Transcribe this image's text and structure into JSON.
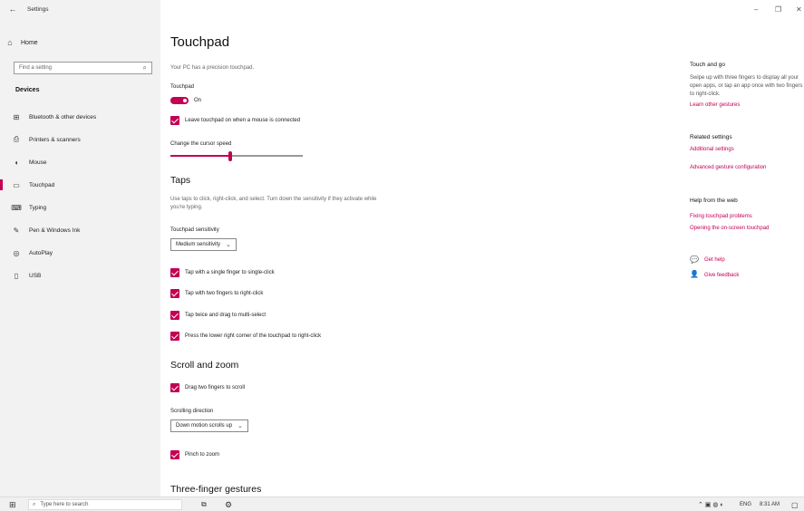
{
  "window": {
    "title": "Settings",
    "back_icon": "←",
    "minimize": "–",
    "restore": "❐",
    "close": "✕"
  },
  "sidebar": {
    "home": {
      "icon": "⌂",
      "label": "Home"
    },
    "search": {
      "placeholder": "Find a setting"
    },
    "section": "Devices",
    "items": [
      {
        "icon": "⊞",
        "label": "Bluetooth & other devices"
      },
      {
        "icon": "⎙",
        "label": "Printers & scanners"
      },
      {
        "icon": "◖",
        "label": "Mouse"
      },
      {
        "icon": "▭",
        "label": "Touchpad",
        "active": true
      },
      {
        "icon": "⌨",
        "label": "Typing"
      },
      {
        "icon": "✎",
        "label": "Pen & Windows Ink"
      },
      {
        "icon": "◎",
        "label": "AutoPlay"
      },
      {
        "icon": "▯",
        "label": "USB"
      }
    ]
  },
  "main": {
    "title": "Touchpad",
    "precision_note": "Your PC has a precision touchpad.",
    "touchpad_label": "Touchpad",
    "touchpad_state": "On",
    "leave_on_label": "Leave touchpad on when a mouse is connected",
    "cursor_speed_label": "Change the cursor speed",
    "cursor_speed_fraction": 0.45,
    "taps": {
      "heading": "Taps",
      "description": "Use taps to click, right-click, and select. Turn down the sensitivity if they activate while you're typing.",
      "sensitivity_label": "Touchpad sensitivity",
      "sensitivity_value": "Medium sensitivity",
      "options": [
        "Tap with a single finger to single-click",
        "Tap with two fingers to right-click",
        "Tap twice and drag to multi-select",
        "Press the lower right corner of the touchpad to right-click"
      ]
    },
    "scroll": {
      "heading": "Scroll and zoom",
      "drag_label": "Drag two fingers to scroll",
      "direction_label": "Scrolling direction",
      "direction_value": "Down motion scrolls up",
      "pinch_label": "Pinch to zoom"
    },
    "three_finger_heading": "Three-finger gestures"
  },
  "right_pane": {
    "touch_heading": "Touch and go",
    "touch_text": "Swipe up with three fingers to display all your open apps, or tap an app once with two fingers to right-click.",
    "learn_link": "Learn other gestures",
    "related_heading": "Related settings",
    "additional_link": "Additional settings",
    "advanced_link": "Advanced gesture configuration",
    "help_heading": "Help from the web",
    "fixing_link": "Fixing touchpad problems",
    "opening_link": "Opening the on-screen touchpad",
    "get_help": "Get help",
    "feedback": "Give feedback"
  },
  "taskbar": {
    "search_placeholder": "Type here to search",
    "lang": "ENG",
    "time": "8:31 AM"
  },
  "colors": {
    "accent": "#c30052",
    "sidebar_bg": "#f2f2f2"
  }
}
